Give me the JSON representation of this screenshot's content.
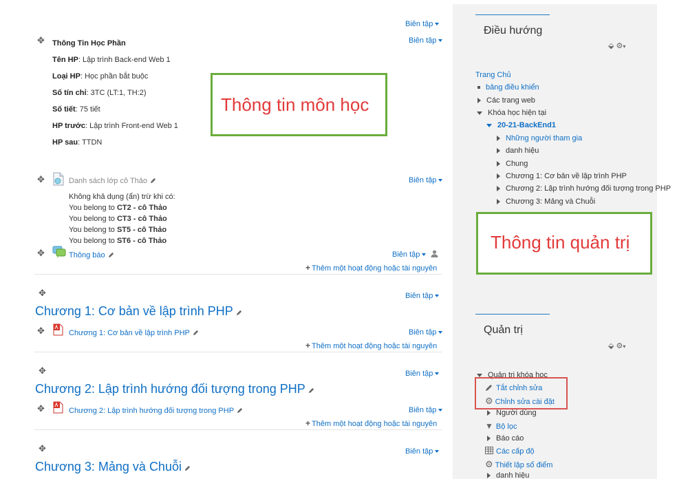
{
  "common": {
    "edit_label": "Biên tập",
    "add_activity_label": "Thêm một hoạt động hoặc tài nguyên"
  },
  "course_info": {
    "heading": "Thông Tin Học Phần",
    "rows": [
      {
        "label": "Tên HP",
        "value": ": Lập trình Back-end Web 1"
      },
      {
        "label": "Loại HP",
        "value": ": Học phần bắt buộc"
      },
      {
        "label": "Số tín chỉ",
        "value": ": 3TC (LT:1, TH:2)"
      },
      {
        "label": "Số tiết",
        "value": ": 75 tiết"
      },
      {
        "label": "HP trước",
        "value": ": Lập trình Front-end Web 1"
      },
      {
        "label": "HP sau",
        "value": ":  TTDN"
      }
    ]
  },
  "annotations": {
    "course_box": "Thông tin môn học",
    "admin_box": "Thông tin quản trị"
  },
  "class_list": {
    "title": "Danh sách lớp cô Thảo",
    "restriction_note": "Không khả dụng (ẩn) trừ khi có:",
    "prefix": "You belong to",
    "groups": [
      "CT2 - cô Thảo",
      "CT3 - cô Thảo",
      "ST5 - cô Thảo",
      "ST6 - cô Thảo"
    ]
  },
  "announcements": {
    "title": "Thông báo"
  },
  "sections": [
    {
      "title": "Chương 1: Cơ bản về lập trình PHP",
      "resource": "Chương 1: Cơ bản về lập trình PHP"
    },
    {
      "title": "Chương 2: Lập trình hướng đối tượng trong PHP",
      "resource": "Chương 2: Lập trình hướng đối tượng trong PHP"
    },
    {
      "title": "Chương 3: Mảng và Chuỗi"
    }
  ],
  "navigation": {
    "title": "Điều hướng",
    "home": "Trang Chủ",
    "dashboard": "bảng điều khiển",
    "site_pages": "Các trang web",
    "current_courses": "Khóa học hiện tại",
    "course": "20-21-BackEnd1",
    "participants": "Những người tham gia",
    "badges": "danh hiệu",
    "general": "Chung",
    "ch1": "Chương 1: Cơ bản về lập trình PHP",
    "ch2": "Chương 2: Lập trình hướng đối tượng trong PHP",
    "ch3": "Chương 3: Mảng và Chuỗi"
  },
  "admin": {
    "title": "Quản trị",
    "course_admin": "Quản trị khóa học",
    "turn_editing_off": "Tắt chỉnh sửa",
    "edit_settings": "Chỉnh sửa cài đặt",
    "users": "Người dùng",
    "filters": "Bộ lọc",
    "reports": "Báo cáo",
    "gradebook": "Các cấp độ",
    "gradebook_setup": "Thiết lập sổ điểm",
    "badges": "danh hiệu"
  }
}
